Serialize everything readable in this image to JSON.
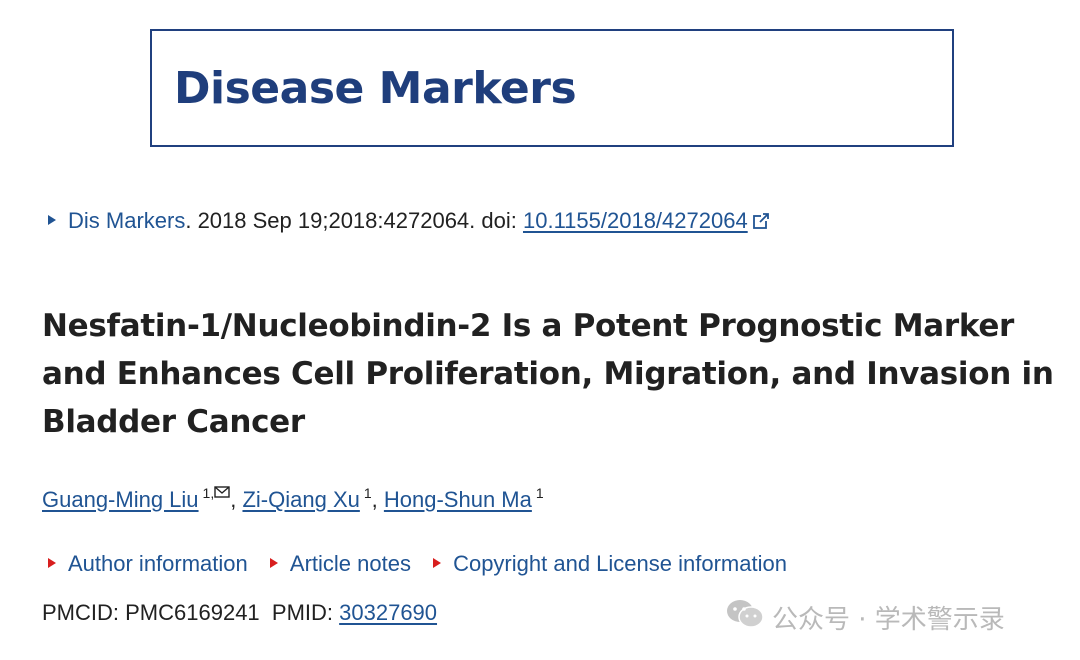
{
  "journal": {
    "name": "Disease Markers"
  },
  "citation": {
    "journal_abbrev": "Dis Markers",
    "details": ". 2018 Sep 19;2018:4272064. doi: ",
    "doi": "10.1155/2018/4272064"
  },
  "article": {
    "title": "Nesfatin-1/Nucleobindin-2 Is a Potent Prognostic Marker and Enhances Cell Proliferation, Migration, and Invasion in Bladder Cancer"
  },
  "authors": [
    {
      "name": "Guang-Ming Liu",
      "affil": "1,",
      "has_mail": true
    },
    {
      "name": "Zi-Qiang Xu",
      "affil": "1",
      "has_mail": false
    },
    {
      "name": "Hong-Shun Ma",
      "affil": "1",
      "has_mail": false
    }
  ],
  "author_separator": ", ",
  "info_links": {
    "author_info": "Author information",
    "article_notes": "Article notes",
    "copyright": "Copyright and License information"
  },
  "ids": {
    "pmcid_label": "PMCID: ",
    "pmcid": "PMC6169241",
    "pmid_label": "PMID: ",
    "pmid": "30327690"
  },
  "watermark": {
    "text": "公众号 · 学术警示录"
  },
  "colors": {
    "link": "#205493",
    "journal_brand": "#1f3e7c",
    "triangle_red": "#d81e1e",
    "text": "#212121"
  }
}
